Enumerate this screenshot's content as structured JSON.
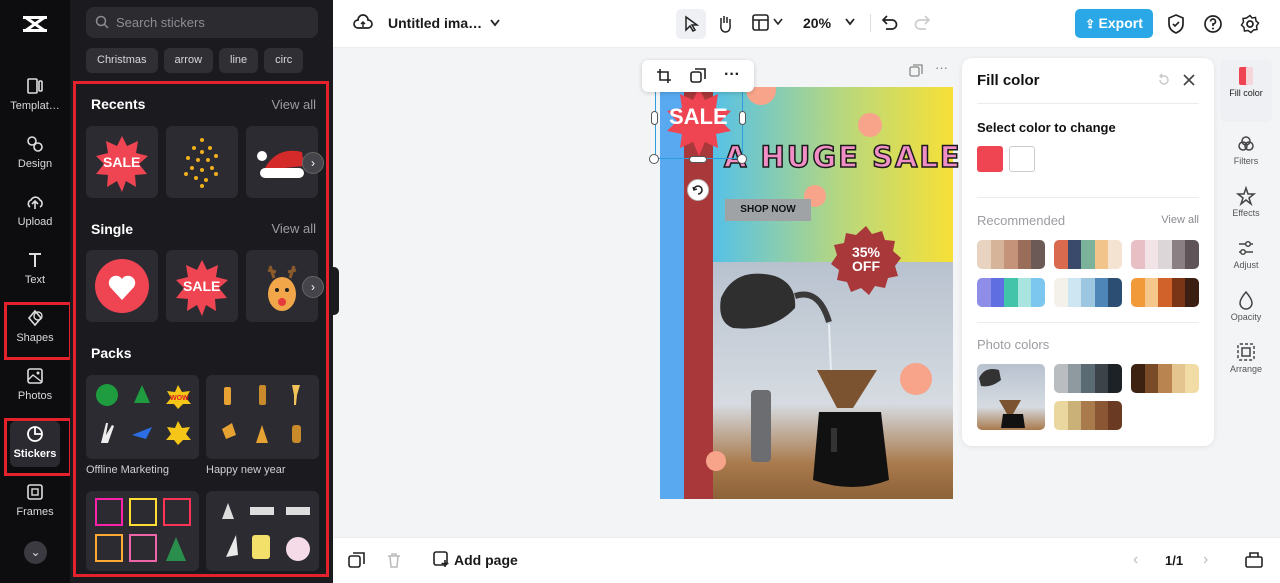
{
  "rail": {
    "items": [
      {
        "label": "Templat…",
        "icon": "templates-icon"
      },
      {
        "label": "Design",
        "icon": "design-icon"
      },
      {
        "label": "Upload",
        "icon": "upload-icon"
      },
      {
        "label": "Text",
        "icon": "text-icon"
      },
      {
        "label": "Shapes",
        "icon": "shapes-icon"
      },
      {
        "label": "Photos",
        "icon": "photos-icon"
      },
      {
        "label": "Stickers",
        "icon": "stickers-icon"
      },
      {
        "label": "Frames",
        "icon": "frames-icon"
      }
    ],
    "active": "Stickers"
  },
  "panel": {
    "search_placeholder": "Search stickers",
    "chips": [
      "Christmas",
      "arrow",
      "line",
      "circ"
    ],
    "recents_title": "Recents",
    "single_title": "Single",
    "packs_title": "Packs",
    "view_all": "View all",
    "recent_sale": "SALE",
    "single_sale": "SALE",
    "packs": [
      {
        "label": "Offline Marketing"
      },
      {
        "label": "Happy new year"
      }
    ],
    "wow": "WOW"
  },
  "topbar": {
    "title": "Untitled ima…",
    "zoom": "20%",
    "export": "Export"
  },
  "design": {
    "sale_sticker": "SALE",
    "headline": "A HUGE SALE",
    "shop_now": "SHOP NOW",
    "discount_line1": "35%",
    "discount_line2": "OFF"
  },
  "fill": {
    "title": "Fill color",
    "select_label": "Select color to change",
    "swatches": [
      "#ef4452",
      "#ffffff"
    ],
    "recommended": "Recommended",
    "view_all": "View all",
    "photo_colors": "Photo colors"
  },
  "right_rail": [
    {
      "label": "Fill color",
      "icon": "fill-color-icon"
    },
    {
      "label": "Filters",
      "icon": "filters-icon"
    },
    {
      "label": "Effects",
      "icon": "effects-icon"
    },
    {
      "label": "Adjust",
      "icon": "adjust-icon"
    },
    {
      "label": "Opacity",
      "icon": "opacity-icon"
    },
    {
      "label": "Arrange",
      "icon": "arrange-icon"
    }
  ],
  "bottombar": {
    "add_page": "Add page",
    "page": "1/1"
  }
}
